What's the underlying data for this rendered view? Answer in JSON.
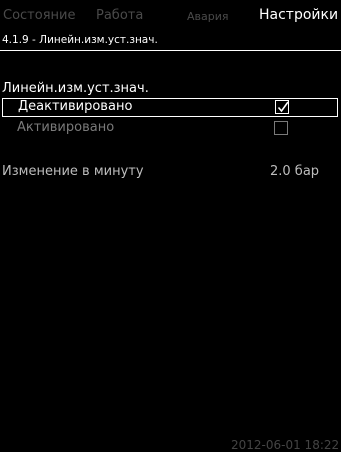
{
  "tabs": [
    {
      "label": "Состояние"
    },
    {
      "label": "Работа"
    },
    {
      "label": "Авария"
    },
    {
      "label": "Настройки"
    }
  ],
  "active_tab": "Настройки",
  "screen_id": "4.1.9 - Линейн.изм.уст.знач.",
  "section_title": "Линейн.изм.уст.знач.",
  "options": [
    {
      "label": "Деактивировано",
      "checked": true
    },
    {
      "label": "Активировано",
      "checked": false
    }
  ],
  "parameter": {
    "label": "Изменение в минуту",
    "value": "2.0 бар"
  },
  "datetime": "2012-06-01 18:22",
  "colors": {
    "background": "#000000",
    "text": "#ffffff",
    "inactive_tab": "#4a4a4a",
    "disabled": "#7a7a7a"
  },
  "icons": {
    "checked": "check-icon",
    "unchecked": "empty-checkbox-icon"
  }
}
